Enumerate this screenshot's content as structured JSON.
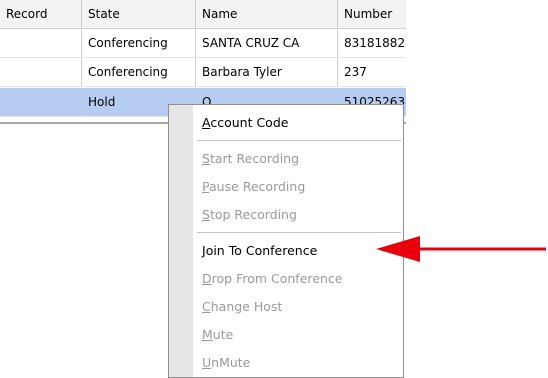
{
  "table": {
    "headers": [
      "Record",
      "State",
      "Name",
      "Number"
    ],
    "rows": [
      {
        "record": "",
        "state": "Conferencing",
        "name": "SANTA CRUZ  CA",
        "number": "83181882"
      },
      {
        "record": "",
        "state": "Conferencing",
        "name": "Barbara Tyler",
        "number": "237"
      },
      {
        "record": "",
        "state": "Hold",
        "name": "O",
        "number": "51025263"
      }
    ]
  },
  "context_menu": {
    "items": [
      {
        "mnemonic": "A",
        "rest": "ccount Code",
        "enabled": true
      },
      {
        "mnemonic": "S",
        "rest": "tart Recording",
        "enabled": false
      },
      {
        "mnemonic": "P",
        "rest": "ause Recording",
        "enabled": false
      },
      {
        "mnemonic": "S",
        "rest": "top Recording",
        "enabled": false
      },
      {
        "mnemonic": "J",
        "rest": "oin To Conference",
        "enabled": true
      },
      {
        "mnemonic": "D",
        "rest": "rop From Conference",
        "enabled": false
      },
      {
        "mnemonic": "C",
        "rest": "hange Host",
        "enabled": false
      },
      {
        "mnemonic": "M",
        "rest": "ute",
        "enabled": false
      },
      {
        "mnemonic": "U",
        "rest": "nMute",
        "enabled": false
      }
    ]
  },
  "annotation": {
    "arrow_color": "#e8000b",
    "target_item": "Join To Conference"
  }
}
